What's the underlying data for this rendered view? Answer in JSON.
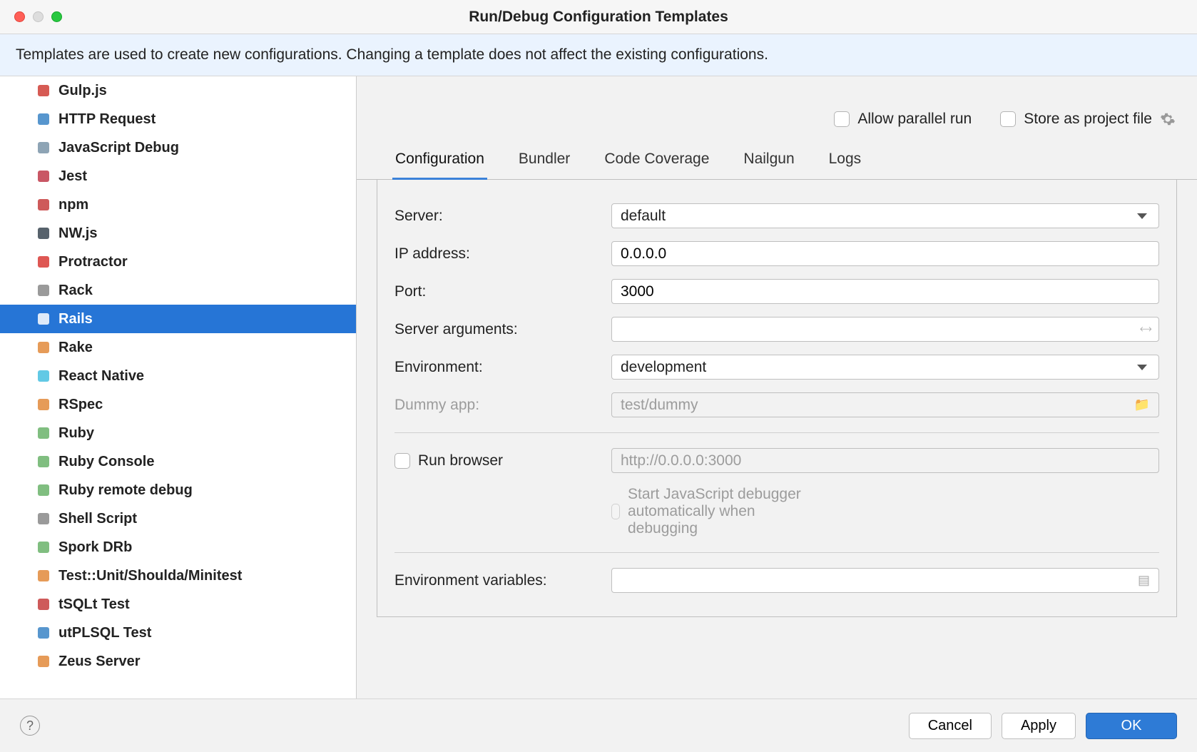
{
  "title": "Run/Debug Configuration Templates",
  "banner": "Templates are used to create new configurations. Changing a template does not affect the existing configurations.",
  "sidebar": {
    "items": [
      {
        "label": "Gulp.js",
        "icon": "gulp",
        "color": "#cf3e36"
      },
      {
        "label": "HTTP Request",
        "icon": "api",
        "color": "#3a84c5"
      },
      {
        "label": "JavaScript Debug",
        "icon": "jsdebug",
        "color": "#7a94a8"
      },
      {
        "label": "Jest",
        "icon": "jest",
        "color": "#c0394a"
      },
      {
        "label": "npm",
        "icon": "npm",
        "color": "#c53d3d"
      },
      {
        "label": "NW.js",
        "icon": "nw",
        "color": "#3a4752"
      },
      {
        "label": "Protractor",
        "icon": "protractor",
        "color": "#d83a35"
      },
      {
        "label": "Rack",
        "icon": "rack",
        "color": "#888"
      },
      {
        "label": "Rails",
        "icon": "rails",
        "color": "#b9653b"
      },
      {
        "label": "Rake",
        "icon": "rake",
        "color": "#e28a3b"
      },
      {
        "label": "React Native",
        "icon": "react",
        "color": "#47c0e0"
      },
      {
        "label": "RSpec",
        "icon": "rspec",
        "color": "#e28a3b"
      },
      {
        "label": "Ruby",
        "icon": "ruby",
        "color": "#6ab36a"
      },
      {
        "label": "Ruby Console",
        "icon": "rubyconsole",
        "color": "#6ab36a"
      },
      {
        "label": "Ruby remote debug",
        "icon": "rubyremote",
        "color": "#6ab36a"
      },
      {
        "label": "Shell Script",
        "icon": "shell",
        "color": "#888"
      },
      {
        "label": "Spork DRb",
        "icon": "spork",
        "color": "#6ab36a"
      },
      {
        "label": "Test::Unit/Shoulda/Minitest",
        "icon": "test",
        "color": "#e28a3b"
      },
      {
        "label": "tSQLt Test",
        "icon": "tsqlt",
        "color": "#c53d3d"
      },
      {
        "label": "utPLSQL Test",
        "icon": "utplsql",
        "color": "#3a84c5"
      },
      {
        "label": "Zeus Server",
        "icon": "zeus",
        "color": "#e28a3b"
      }
    ],
    "selected": 8
  },
  "toprow": {
    "allow_parallel_label": "Allow parallel run",
    "store_project_label": "Store as project file"
  },
  "tabs": [
    "Configuration",
    "Bundler",
    "Code Coverage",
    "Nailgun",
    "Logs"
  ],
  "active_tab": 0,
  "form": {
    "server_label": "Server:",
    "server_value": "default",
    "ip_label": "IP address:",
    "ip_value": "0.0.0.0",
    "port_label": "Port:",
    "port_value": "3000",
    "serverargs_label": "Server arguments:",
    "serverargs_value": "",
    "env_label": "Environment:",
    "env_value": "development",
    "dummy_label": "Dummy app:",
    "dummy_value": "test/dummy",
    "runbrowser_label": "Run browser",
    "runbrowser_url": "http://0.0.0.0:3000",
    "startjs_label": "Start JavaScript debugger automatically when debugging",
    "envvars_label": "Environment variables:",
    "envvars_value": ""
  },
  "footer": {
    "cancel": "Cancel",
    "apply": "Apply",
    "ok": "OK"
  }
}
